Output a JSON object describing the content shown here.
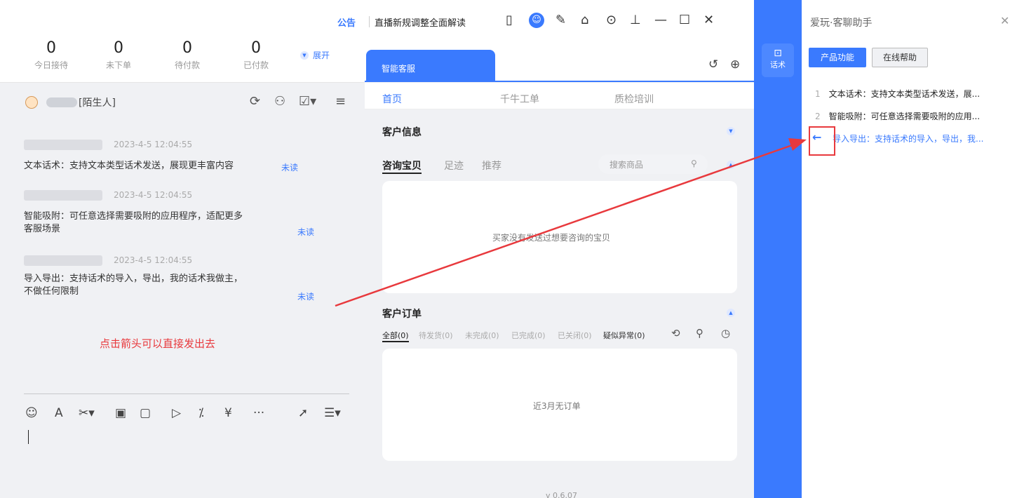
{
  "stats": [
    {
      "num": "0",
      "label": "今日接待"
    },
    {
      "num": "0",
      "label": "未下单"
    },
    {
      "num": "0",
      "label": "待付款"
    },
    {
      "num": "0",
      "label": "已付款"
    }
  ],
  "expand_label": "展开",
  "customer": {
    "suffix": "[陌生人]"
  },
  "messages": [
    {
      "time": "2023-4-5 12:04:55",
      "text": "文本话术：支持文本类型话术发送，展现更丰富内容",
      "status": "未读"
    },
    {
      "time": "2023-4-5 12:04:55",
      "text": "智能吸附：可任意选择需要吸附的应用程序，适配更多\n客服场景",
      "status": "未读"
    },
    {
      "time": "2023-4-5 12:04:55",
      "text": "导入导出：支持话术的导入，导出，我的话术我做主，\n不做任何限制",
      "status": "未读"
    }
  ],
  "hint": "点击箭头可以直接发出去",
  "topbar": {
    "announce": "公告",
    "notice": "直播新规调整全面解读"
  },
  "middle": {
    "tab": "智能客服",
    "subtabs": [
      "首页",
      "千牛工单",
      "质检培训"
    ],
    "customer_info": "客户信息",
    "product_tabs": [
      "咨询宝贝",
      "足迹",
      "推荐"
    ],
    "search_placeholder": "搜索商品",
    "empty_product": "买家没有发送过想要咨询的宝贝",
    "orders_title": "客户订单",
    "order_tabs": [
      "全部(0)",
      "待发货(0)",
      "未完成(0)",
      "已完成(0)",
      "已关闭(0)",
      "疑似异常(0)"
    ],
    "empty_orders": "近3月无订单",
    "footer_text": "v 0.6.07"
  },
  "strip": {
    "label": "话术"
  },
  "assistant": {
    "title": "爱玩·客聊助手",
    "btn_product": "产品功能",
    "btn_help": "在线帮助",
    "items": [
      {
        "n": "1",
        "text": "文本话术：支持文本类型话术发送，展..."
      },
      {
        "n": "2",
        "text": "智能吸附：可任意选择需要吸附的应用..."
      },
      {
        "n": "",
        "text": "导入导出：支持话术的导入，导出，我..."
      }
    ]
  },
  "colors": {
    "accent": "#3a7afe",
    "hint": "#e8393d"
  }
}
